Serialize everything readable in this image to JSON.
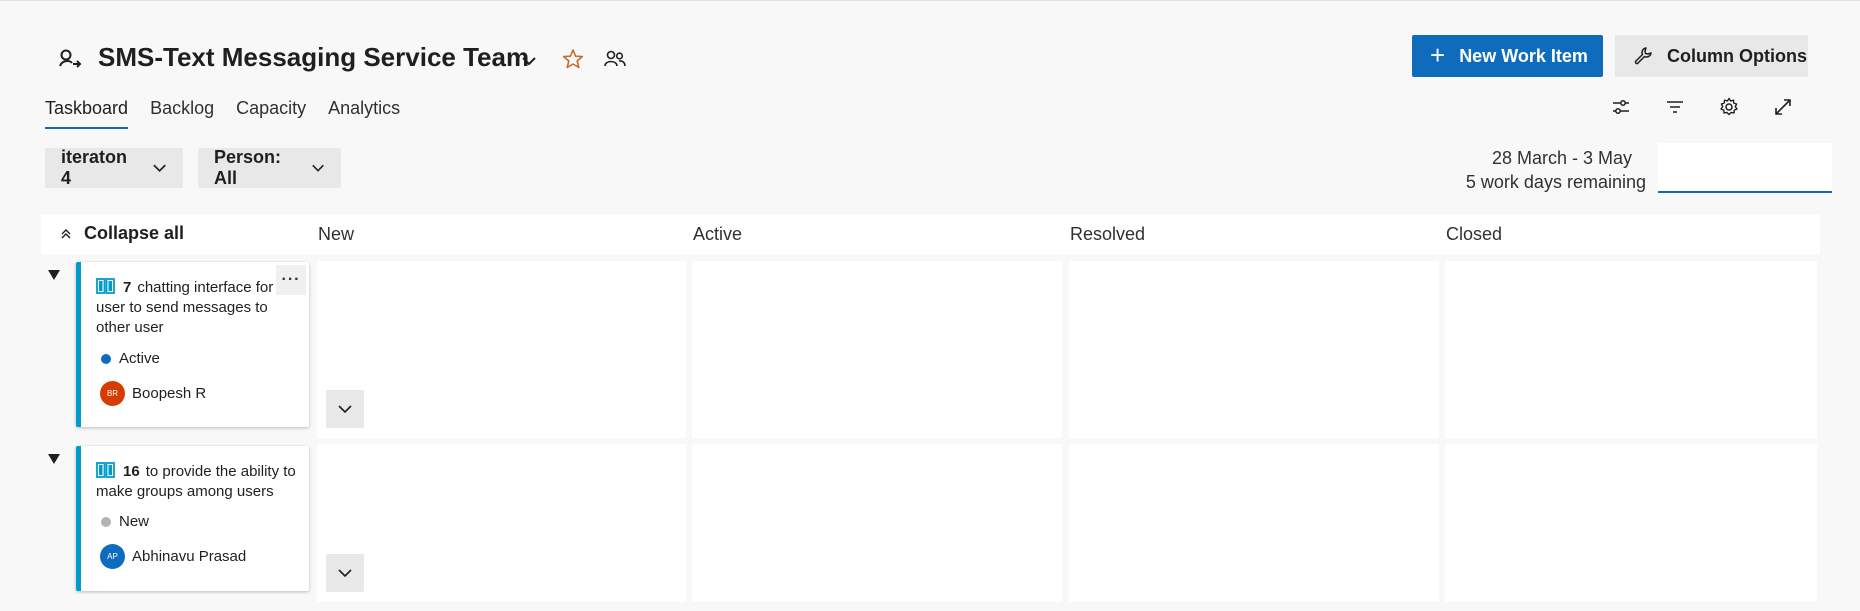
{
  "header": {
    "team_name": "SMS-Text Messaging Service Team",
    "new_item_label": "New Work Item",
    "column_options_label": "Column Options"
  },
  "tabs": [
    {
      "label": "Taskboard",
      "active": true
    },
    {
      "label": "Backlog",
      "active": false
    },
    {
      "label": "Capacity",
      "active": false
    },
    {
      "label": "Analytics",
      "active": false
    }
  ],
  "toolbar_icons": [
    "view-options-icon",
    "filter-icon",
    "settings-icon",
    "fullscreen-icon"
  ],
  "filters": {
    "iteration": "iteraton 4",
    "person": "Person: All"
  },
  "sprint": {
    "dates": "28 March - 3 May",
    "remaining": "5 work days remaining"
  },
  "board": {
    "collapse_all": "Collapse all",
    "columns": [
      "New",
      "Active",
      "Resolved",
      "Closed"
    ],
    "rows": [
      {
        "id": "7",
        "title": "chatting interface for user to send messages to other user",
        "state": "Active",
        "state_color": "#0f6cbd",
        "assignee": "Boopesh R",
        "initials": "BR",
        "avatar_color": "#d83b01"
      },
      {
        "id": "16",
        "title": "to provide the ability to make groups among users",
        "state": "New",
        "state_color": "#b3b3b3",
        "assignee": "Abhinavu Prasad",
        "initials": "AP",
        "avatar_color": "#0f6cbd"
      }
    ]
  },
  "colors": {
    "accent": "#0f6cbd",
    "card_border": "#009ccc",
    "favorite": "#c76b2a"
  }
}
